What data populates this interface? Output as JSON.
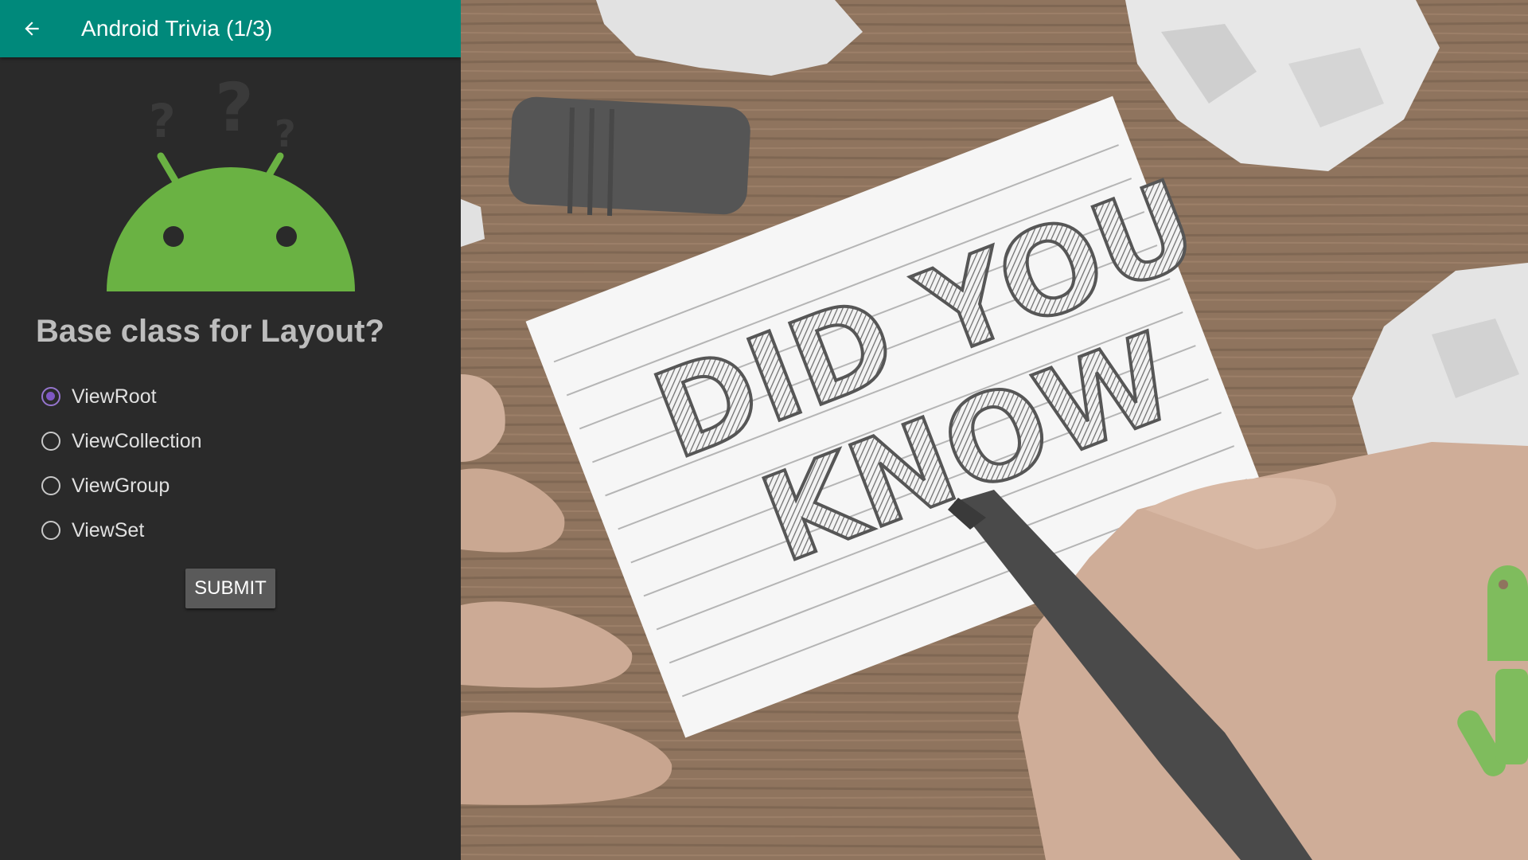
{
  "appbar": {
    "title": "Android Trivia (1/3)",
    "back_icon": "arrow-back-icon",
    "color": "#00897b"
  },
  "question": {
    "text": "Base class for Layout?",
    "options": [
      {
        "label": "ViewRoot",
        "checked": true
      },
      {
        "label": "ViewCollection",
        "checked": false
      },
      {
        "label": "ViewGroup",
        "checked": false
      },
      {
        "label": "ViewSet",
        "checked": false
      }
    ],
    "submit_label": "SUBMIT"
  },
  "photo": {
    "card_text_line1": "DID YOU",
    "card_text_line2": "KNOW"
  },
  "colors": {
    "android_green": "#6ab243",
    "radio_accent": "#7e57c2",
    "panel_bg": "#2a2a2a"
  }
}
